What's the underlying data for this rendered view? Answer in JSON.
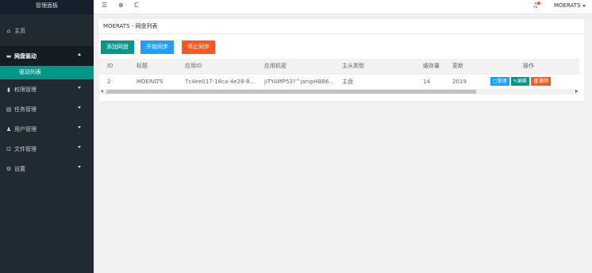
{
  "sidebar": {
    "brand": "管理面板",
    "home": {
      "label": "主页",
      "icon": "home-icon"
    },
    "items": [
      {
        "label": "网盘驱动",
        "icon": "server-icon"
      },
      {
        "label": "权限管理",
        "icon": "lock-icon"
      },
      {
        "label": "任务管理",
        "icon": "list-icon"
      },
      {
        "label": "用户管理",
        "icon": "users-icon"
      },
      {
        "label": "文件管理",
        "icon": "folder-icon"
      },
      {
        "label": "设置",
        "icon": "gear-icon"
      }
    ],
    "subitem": {
      "label": "驱动列表"
    }
  },
  "header": {
    "menu_icon": "☰",
    "globe_icon": "⊕",
    "refresh_icon": "C",
    "bell_icon": "♫",
    "user": "MOERATS"
  },
  "card": {
    "title": "MOERATS - 网盘列表",
    "buttons": {
      "add": "添加网盘",
      "start": "开始同步",
      "stop": "停止同步"
    }
  },
  "table": {
    "headers": [
      "ID",
      "标题",
      "应用ID",
      "应用机密",
      "主从类型",
      "缓存量",
      "更新",
      "操作"
    ],
    "rows": [
      {
        "id": "2",
        "title": "MOERATS",
        "app_id": "7c4ee017-18ca-4e28-8...",
        "secret": "jiTYAMP53?^janipHB86...",
        "type": "主盘",
        "cache": "14",
        "updated": "2019",
        "actions": {
          "manage": "管理",
          "edit": "编辑",
          "delete": "删除"
        }
      }
    ]
  },
  "colors": {
    "sidebar_bg": "#1f2a33",
    "accent_green": "#009688",
    "accent_blue": "#1e9fff",
    "accent_red": "#ff5722"
  }
}
